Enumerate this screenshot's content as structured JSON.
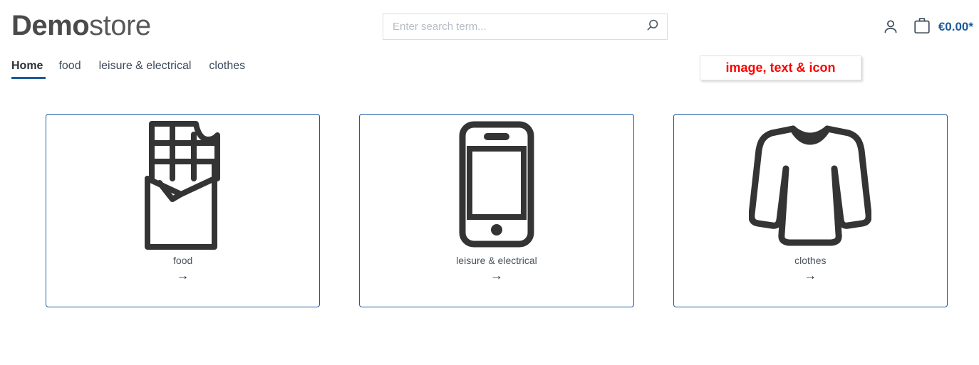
{
  "header": {
    "logo_strong": "Demo",
    "logo_light": "store",
    "search": {
      "placeholder": "Enter search term...",
      "value": "",
      "icon": "search-icon"
    },
    "account_icon": "person-icon",
    "cart_icon": "shopping-bag-icon",
    "cart_amount": "€0.00*"
  },
  "nav": {
    "items": [
      {
        "label": "Home",
        "active": true
      },
      {
        "label": "food",
        "active": false
      },
      {
        "label": "leisure & electrical",
        "active": false
      },
      {
        "label": "clothes",
        "active": false
      }
    ]
  },
  "badge": {
    "text": "image, text & icon",
    "color": "#ff0000"
  },
  "cards": [
    {
      "label": "food",
      "arrow": "→",
      "icon": "chocolate-bar-icon"
    },
    {
      "label": "leisure & electrical",
      "arrow": "→",
      "icon": "smartphone-icon"
    },
    {
      "label": "clothes",
      "arrow": "→",
      "icon": "sweater-icon"
    }
  ],
  "colors": {
    "accent_blue": "#1b5a9c",
    "icon_dark": "#343434",
    "text": "#2b3137",
    "placeholder": "#b6bcc4",
    "alert_red": "#ff0000"
  }
}
